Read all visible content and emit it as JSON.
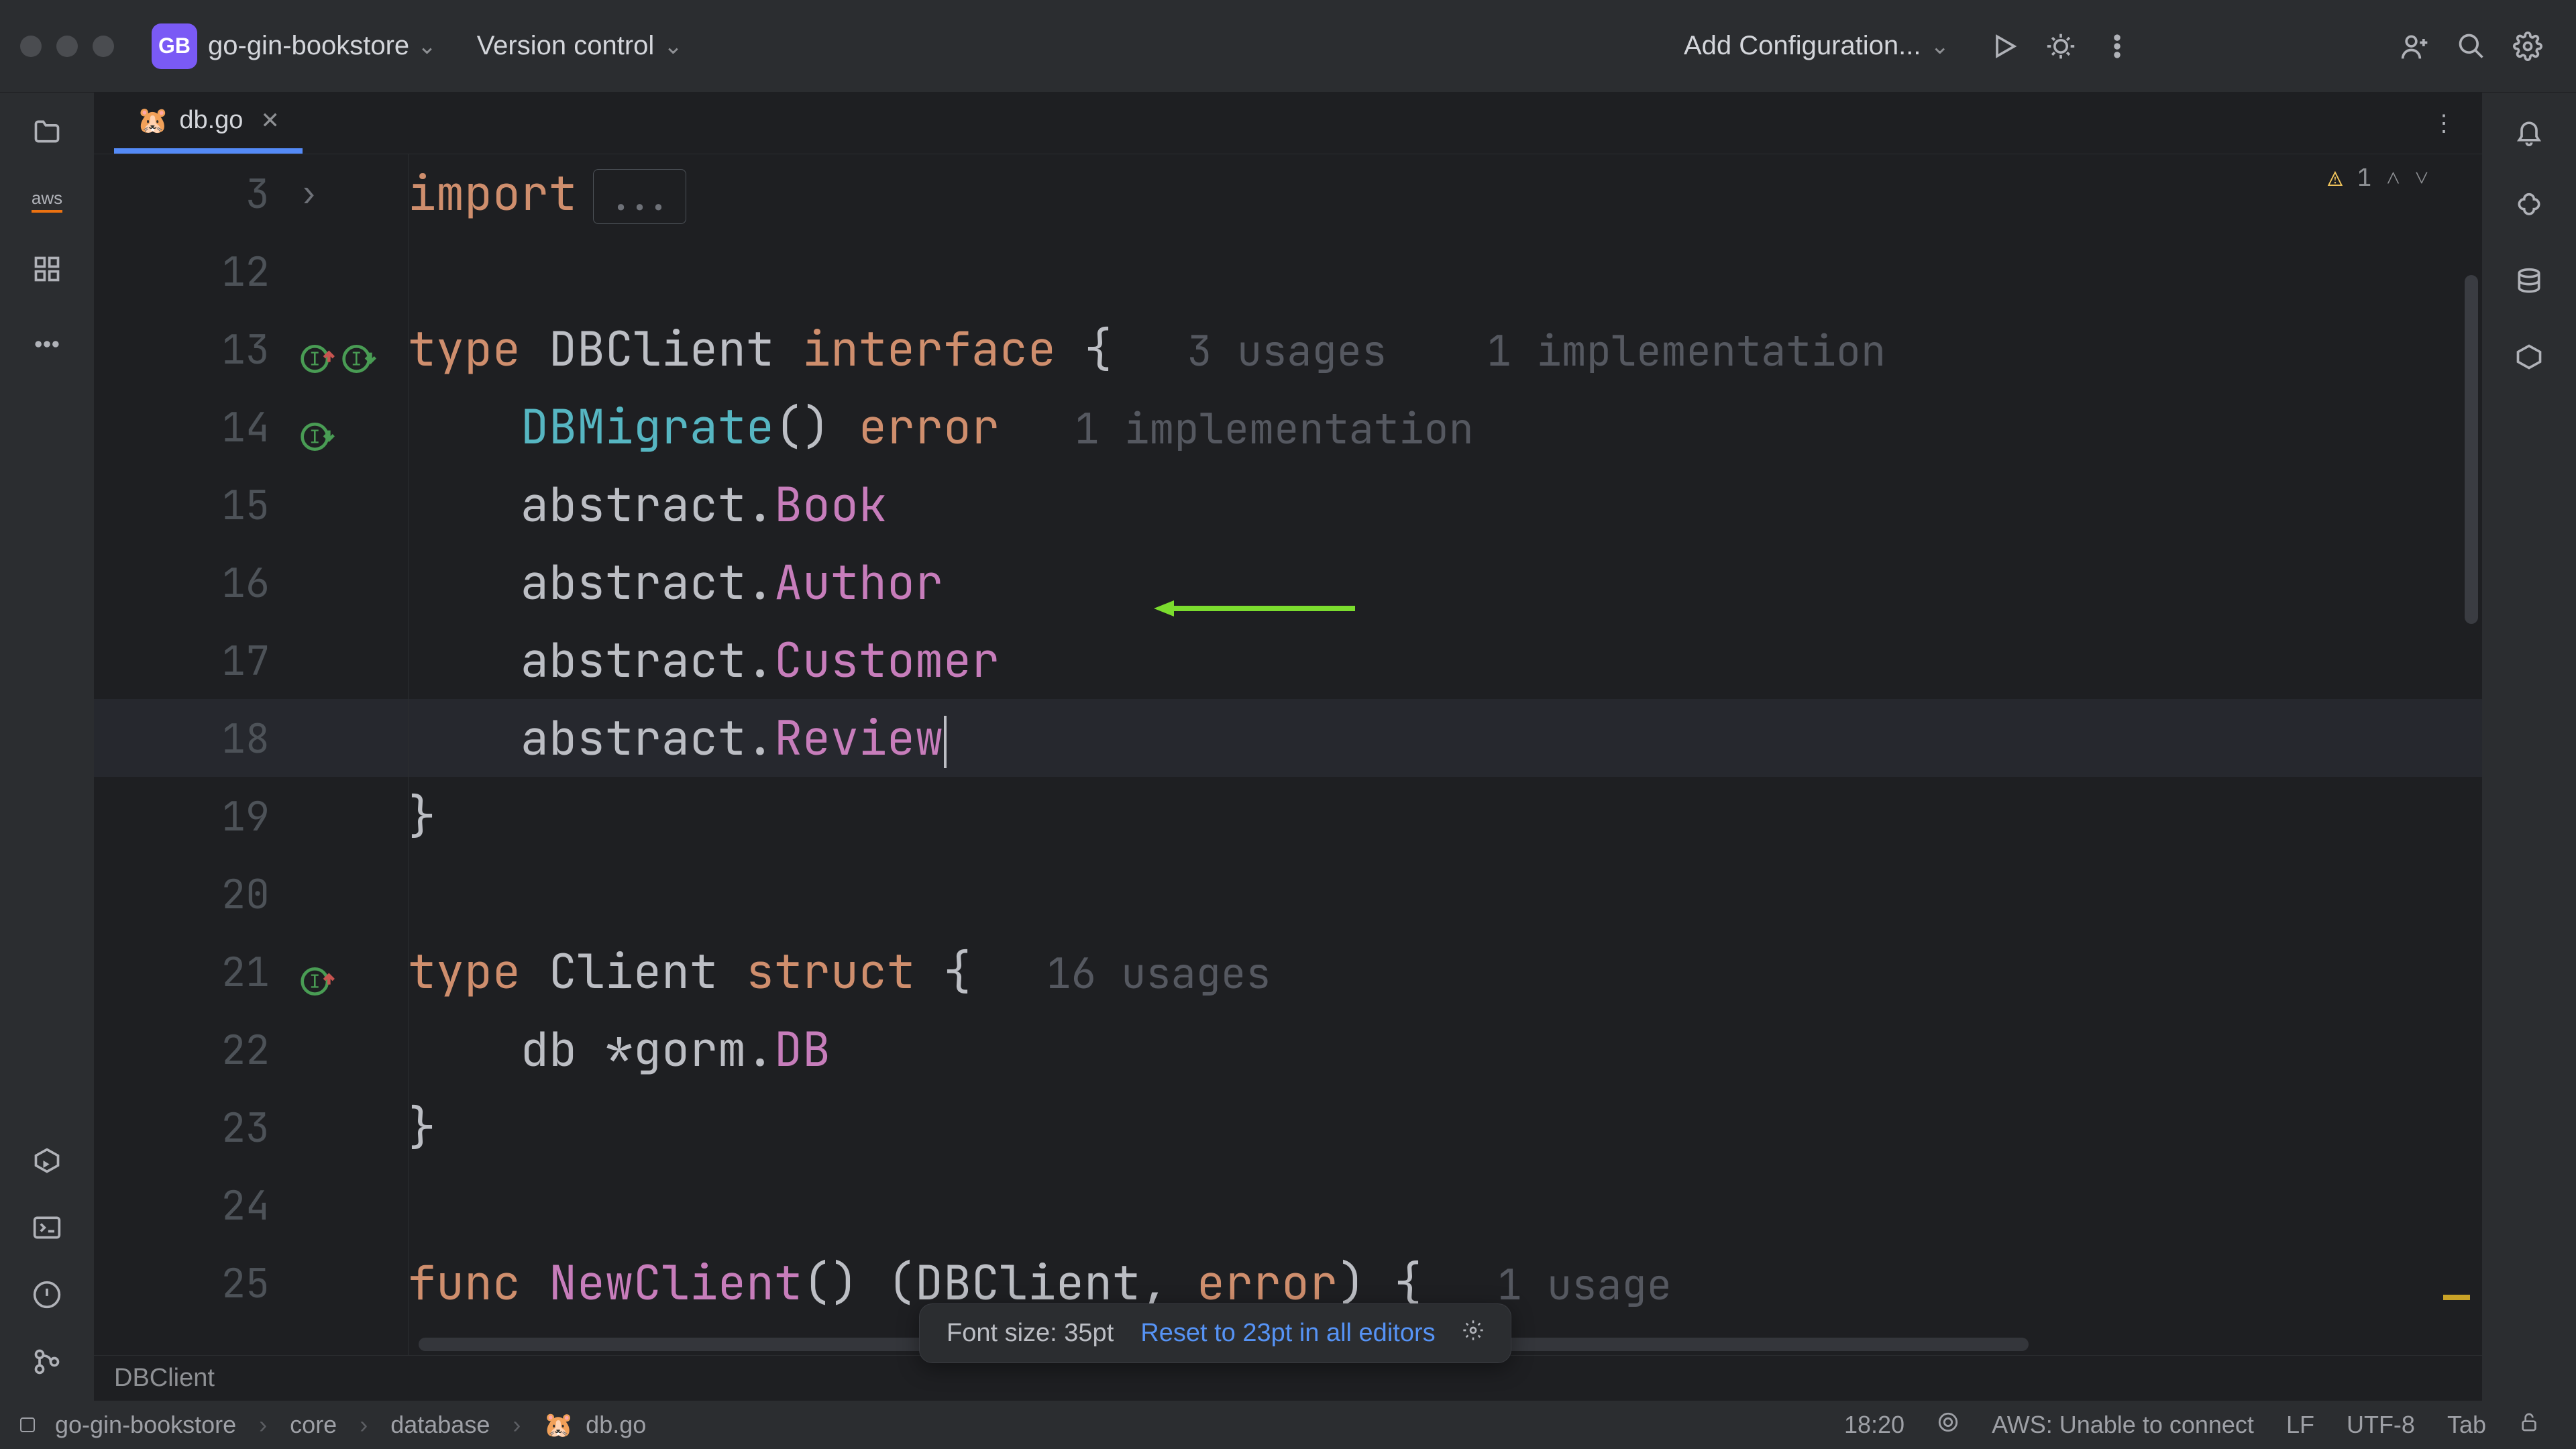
{
  "titlebar": {
    "project_badge": "GB",
    "project_name": "go-gin-bookstore",
    "vcs_label": "Version control",
    "add_config": "Add Configuration..."
  },
  "left_tools": {
    "aws": "aws"
  },
  "tab": {
    "icon": "🐹",
    "filename": "db.go"
  },
  "editor": {
    "warnings_count": "1",
    "lines": [
      {
        "n": "3",
        "fold": true,
        "tokens": [
          {
            "t": "import",
            "c": "kw"
          }
        ],
        "folded": "..."
      },
      {
        "n": "12",
        "tokens": []
      },
      {
        "n": "13",
        "marks": [
          "up",
          "down"
        ],
        "tokens": [
          {
            "t": "type ",
            "c": "kw"
          },
          {
            "t": "DBClient ",
            "c": "typ"
          },
          {
            "t": "interface ",
            "c": "kw"
          },
          {
            "t": "{",
            "c": "typ"
          }
        ],
        "hints": [
          "3 usages",
          "1 implementation"
        ]
      },
      {
        "n": "14",
        "marks": [
          "down"
        ],
        "tokens": [
          {
            "t": "    ",
            "c": ""
          },
          {
            "t": "DBMigrate",
            "c": "fn"
          },
          {
            "t": "() ",
            "c": "typ"
          },
          {
            "t": "error",
            "c": "err"
          }
        ],
        "hints": [
          "1 implementation"
        ]
      },
      {
        "n": "15",
        "tokens": [
          {
            "t": "    ",
            "c": ""
          },
          {
            "t": "abstract",
            "c": "pkg"
          },
          {
            "t": ".",
            "c": "typ"
          },
          {
            "t": "Book",
            "c": "member"
          }
        ]
      },
      {
        "n": "16",
        "tokens": [
          {
            "t": "    ",
            "c": ""
          },
          {
            "t": "abstract",
            "c": "pkg"
          },
          {
            "t": ".",
            "c": "typ"
          },
          {
            "t": "Author",
            "c": "member"
          }
        ],
        "arrow": true
      },
      {
        "n": "17",
        "tokens": [
          {
            "t": "    ",
            "c": ""
          },
          {
            "t": "abstract",
            "c": "pkg"
          },
          {
            "t": ".",
            "c": "typ"
          },
          {
            "t": "Customer",
            "c": "member"
          }
        ]
      },
      {
        "n": "18",
        "current": true,
        "tokens": [
          {
            "t": "    ",
            "c": ""
          },
          {
            "t": "abstract",
            "c": "pkg"
          },
          {
            "t": ".",
            "c": "typ"
          },
          {
            "t": "Review",
            "c": "member"
          }
        ],
        "cursor": true
      },
      {
        "n": "19",
        "tokens": [
          {
            "t": "}",
            "c": "typ"
          }
        ]
      },
      {
        "n": "20",
        "tokens": []
      },
      {
        "n": "21",
        "marks": [
          "up"
        ],
        "tokens": [
          {
            "t": "type ",
            "c": "kw"
          },
          {
            "t": "Client ",
            "c": "typ"
          },
          {
            "t": "struct ",
            "c": "kw"
          },
          {
            "t": "{",
            "c": "typ"
          }
        ],
        "hints": [
          "16 usages"
        ]
      },
      {
        "n": "22",
        "tokens": [
          {
            "t": "    db ",
            "c": "typ"
          },
          {
            "t": "*",
            "c": "typ"
          },
          {
            "t": "gorm",
            "c": "pkg"
          },
          {
            "t": ".",
            "c": "typ"
          },
          {
            "t": "DB",
            "c": "member"
          }
        ]
      },
      {
        "n": "23",
        "tokens": [
          {
            "t": "}",
            "c": "typ"
          }
        ]
      },
      {
        "n": "24",
        "tokens": []
      },
      {
        "n": "25",
        "tokens": [
          {
            "t": "func ",
            "c": "kw"
          },
          {
            "t": "NewClient",
            "c": "iname"
          },
          {
            "t": "() (",
            "c": "typ"
          },
          {
            "t": "DBClient",
            "c": "typ"
          },
          {
            "t": ", ",
            "c": "typ"
          },
          {
            "t": "error",
            "c": "err"
          },
          {
            "t": ") {",
            "c": "typ"
          }
        ],
        "hints": [
          "1 usage"
        ]
      }
    ]
  },
  "breadcrumb_editor": "DBClient",
  "fontpop": {
    "label": "Font size: 35pt",
    "reset": "Reset to 23pt in all editors"
  },
  "status": {
    "crumbs": [
      "go-gin-bookstore",
      "core",
      "database",
      "db.go"
    ],
    "crumb_icon": "🐹",
    "pos": "18:20",
    "aws": "AWS: Unable to connect",
    "eol": "LF",
    "enc": "UTF-8",
    "indent": "Tab"
  }
}
